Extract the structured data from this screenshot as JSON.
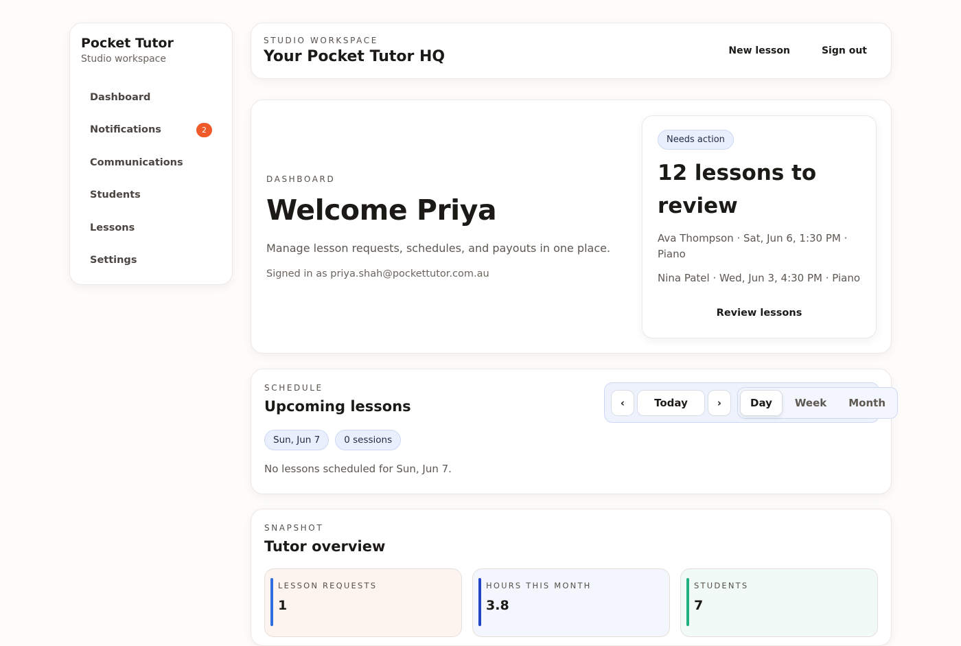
{
  "sidebar": {
    "brand_title": "Pocket Tutor",
    "brand_subtitle": "Studio workspace",
    "items": [
      {
        "label": "Dashboard"
      },
      {
        "label": "Notifications",
        "badge": "2"
      },
      {
        "label": "Communications"
      },
      {
        "label": "Students"
      },
      {
        "label": "Lessons"
      },
      {
        "label": "Settings"
      }
    ]
  },
  "header": {
    "eyebrow": "STUDIO WORKSPACE",
    "title": "Your Pocket Tutor HQ",
    "new_lesson": "New lesson",
    "sign_out": "Sign out"
  },
  "hero": {
    "eyebrow": "DASHBOARD",
    "title": "Welcome Priya",
    "description": "Manage lesson requests, schedules, and payouts in one place.",
    "signed_in": "Signed in as priya.shah@pockettutor.com.au"
  },
  "review": {
    "pill": "Needs action",
    "title": "12 lessons to review",
    "lessons": [
      "Ava Thompson · Sat, Jun 6, 1:30 PM · Piano",
      "Nina Patel · Wed, Jun 3, 4:30 PM · Piano"
    ],
    "button": "Review lessons"
  },
  "schedule": {
    "eyebrow": "SCHEDULE",
    "title": "Upcoming lessons",
    "date_chip": "Sun, Jun 7",
    "sessions_chip": "0 sessions",
    "empty_message": "No lessons scheduled for Sun, Jun 7.",
    "controls": {
      "prev": "‹",
      "today": "Today",
      "next": "›",
      "views": [
        "Day",
        "Week",
        "Month"
      ],
      "active_view": "Day"
    }
  },
  "snapshot": {
    "eyebrow": "SNAPSHOT",
    "title": "Tutor overview",
    "stats": [
      {
        "label": "LESSON REQUESTS",
        "value": "1",
        "accent": "#2f6ee0",
        "bg": "#fdf4ef"
      },
      {
        "label": "HOURS THIS MONTH",
        "value": "3.8",
        "accent": "#2244c9",
        "bg": "#f3f6fd"
      },
      {
        "label": "STUDENTS",
        "value": "7",
        "accent": "#1fb07e",
        "bg": "#f1faf6"
      }
    ]
  },
  "colors": {
    "badge": "#f05a28",
    "pill_bg": "#e9effc"
  }
}
